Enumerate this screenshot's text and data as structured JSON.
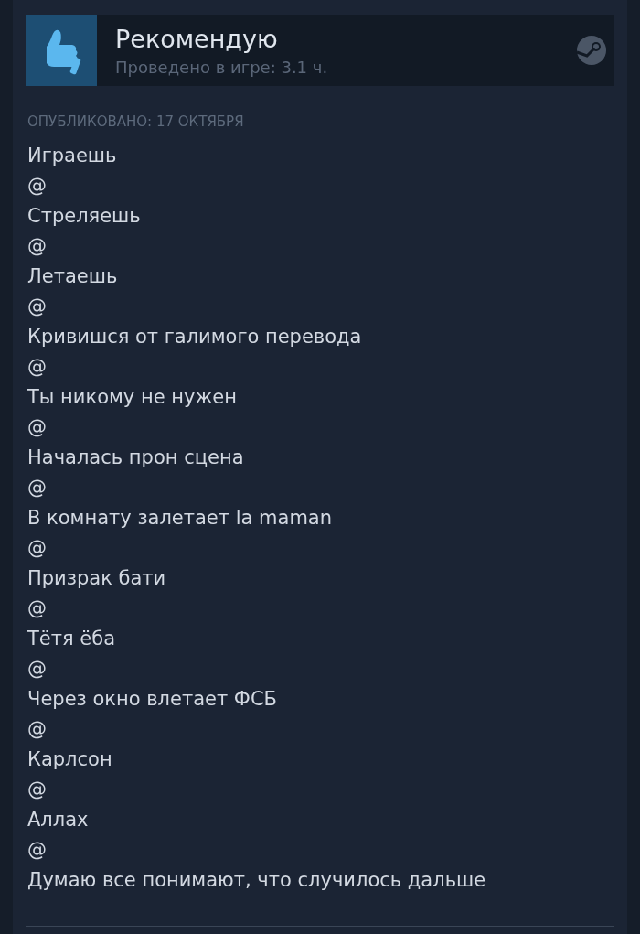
{
  "review": {
    "verdict": "Рекомендую",
    "playtime": "Проведено в игре: 3.1 ч.",
    "recommended": true
  },
  "posted": "ОПУБЛИКОВАНО: 17 ОКТЯБРЯ",
  "lines": [
    "Играешь",
    "@",
    "Стреляешь",
    "@",
    "Летаешь",
    "@",
    "Кривишся от галимого перевода",
    "@",
    "Ты никому не нужен",
    "@",
    "Началась прон сцена",
    "@",
    "В комнату залетает la maman",
    "@",
    "Призрак бати",
    "@",
    "Тётя ёба",
    "@",
    "Через окно влетает ФСБ",
    "@",
    "Карлсон",
    "@",
    "Аллах",
    "@",
    "Думаю все понимают, что случилось дальше"
  ]
}
